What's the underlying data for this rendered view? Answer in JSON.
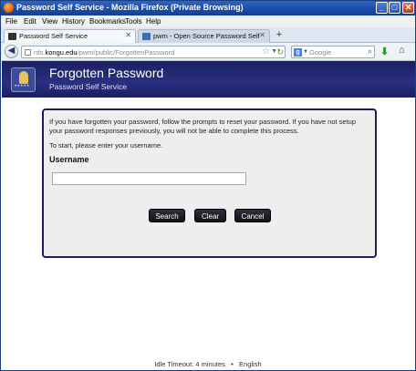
{
  "window": {
    "title": "Password Self Service - Mozilla Firefox (Private Browsing)",
    "min_icon": "_",
    "max_icon": "□",
    "close_icon": "✕"
  },
  "menu": [
    "File",
    "Edit",
    "View",
    "History",
    "Bookmarks",
    "Tools",
    "Help"
  ],
  "tabs": [
    {
      "label": "Password Self Service",
      "active": true
    },
    {
      "label": "pwm - Open Source Password Self Servic...",
      "active": false
    }
  ],
  "new_tab_symbol": "+",
  "navbar": {
    "url_domain": "kongu.edu",
    "url_prefix": "rds.",
    "url_path": "/pwm/public/ForgottenPassword",
    "search_placeholder": "Google",
    "search_engine_letter": "g"
  },
  "header": {
    "title": "Forgotten Password",
    "subtitle": "Password Self Service"
  },
  "form": {
    "intro": "If you have forgotten your password, follow the prompts to reset your password. If you have not setup your password responses previously, you will not be able to complete this process.",
    "prompt": "To start, please enter your username.",
    "username_label": "Username",
    "username_value": "",
    "buttons": {
      "search": "Search",
      "clear": "Clear",
      "cancel": "Cancel"
    }
  },
  "footer": {
    "idle_timeout": "Idle Timeout: 4 minutes",
    "separator": "•",
    "language": "English"
  }
}
